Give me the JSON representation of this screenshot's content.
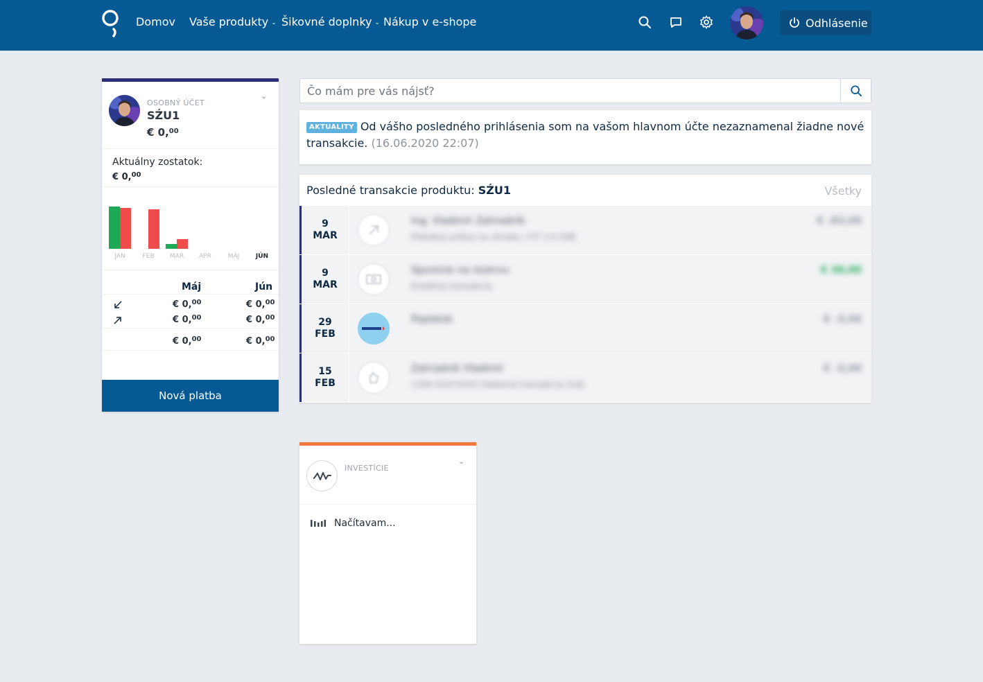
{
  "nav": {
    "home": "Domov",
    "products": "Vaše produkty",
    "addons": "Šikovné doplnky",
    "shop": "Nákup v e-shope",
    "logout": "Odhlásenie",
    "icons": [
      "search-icon",
      "chat-icon",
      "gear-icon"
    ]
  },
  "account": {
    "type": "OSOBNÝ ÚČET",
    "name": "SZU1",
    "name_display": "SŹU1",
    "amount_int": "€ 0,",
    "amount_dec": "00",
    "balance_label": "Aktuálny zostatok:",
    "balance_int": "€ 0,",
    "balance_dec": "00",
    "months": [
      "JAN",
      "FEB",
      "MAR",
      "APR",
      "MÁJ",
      "JÚN"
    ],
    "active_month": "JÚN",
    "table": {
      "col1": "Máj",
      "col2": "Jún",
      "rows": [
        {
          "icon": "incoming-arrow-icon",
          "a_int": "€ 0,",
          "a_dec": "00",
          "b_int": "€ 0,",
          "b_dec": "00"
        },
        {
          "icon": "outgoing-arrow-icon",
          "a_int": "€ 0,",
          "a_dec": "00",
          "b_int": "€ 0,",
          "b_dec": "00"
        }
      ],
      "total": {
        "a_int": "€ 0,",
        "a_dec": "00",
        "b_int": "€ 0,",
        "b_dec": "00"
      }
    },
    "new_payment": "Nová platba"
  },
  "chart_data": {
    "type": "bar",
    "categories": [
      "JAN",
      "FEB",
      "MAR",
      "APR",
      "MÁJ",
      "JÚN"
    ],
    "series": [
      {
        "values": [
          64,
          0,
          7,
          0,
          0,
          0
        ],
        "color": "#1ea957"
      },
      {
        "values": [
          62,
          60,
          15,
          0,
          0,
          0
        ],
        "color": "#f04b4b"
      }
    ],
    "ylim": [
      0,
      70
    ],
    "grid": false
  },
  "search": {
    "placeholder": "Čo mám pre vás nájsť?"
  },
  "news": {
    "badge": "AKTUALITY",
    "text": "Od vášho posledného prihlásenia som na vašom hlavnom účte nezaznamenal žiadne nové transakcie.",
    "time": "(16.06.2020 22:07)"
  },
  "transactions": {
    "title_prefix": "Posledné transakcie produktu:",
    "product": "SŹU1",
    "all_link": "Všetky",
    "items": [
      {
        "day": "9",
        "month": "MAR",
        "icon": "outgoing-arrow-icon",
        "name": "Ing. Vladimír Zahradník",
        "desc": "Platobný príkaz na úhradu / FIT 2.0 SSB",
        "amount": "€ -83,00",
        "positive": false
      },
      {
        "day": "9",
        "month": "MAR",
        "icon": "cash-icon",
        "name": "Sporenie na rezervu",
        "desc": "Kreditná transakcia",
        "amount": "€ 30,00",
        "positive": true
      },
      {
        "day": "29",
        "month": "FEB",
        "icon": "merchant-logo-icon",
        "name": "Poplatok",
        "desc": "",
        "amount": "€ -3,00",
        "positive": false
      },
      {
        "day": "15",
        "month": "FEB",
        "icon": "hand-icon",
        "name": "Zahradník Vladimír",
        "desc": "1309 4197XXXX   Debetná transakcia (iná)",
        "amount": "€ -3,00",
        "positive": false
      }
    ]
  },
  "investments": {
    "label": "INVESTÍCIE",
    "loading": "Načítavam..."
  },
  "colors": {
    "header": "#055a93",
    "accent_account": "#2a2f78",
    "accent_investments": "#f07a3e",
    "income": "#1ea957",
    "expense": "#f04b4b",
    "badge": "#5fb2de"
  }
}
